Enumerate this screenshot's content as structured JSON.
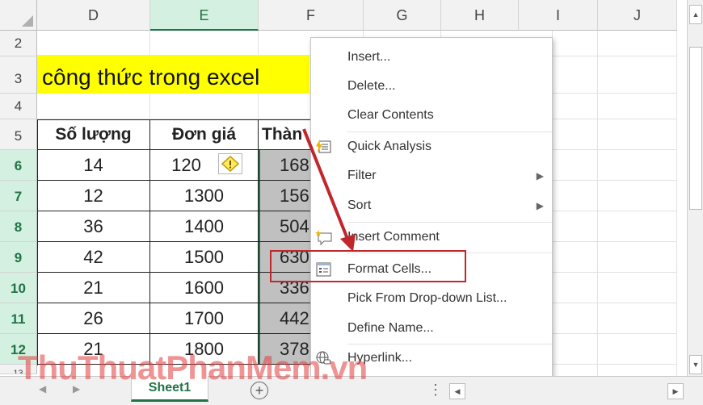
{
  "columns": {
    "d": "D",
    "e": "E",
    "f": "F",
    "g": "G",
    "h": "H",
    "i": "I",
    "j": "J"
  },
  "rows": [
    "2",
    "3",
    "4",
    "5",
    "6",
    "7",
    "8",
    "9",
    "10",
    "11",
    "12",
    "13"
  ],
  "title_cell": "công thức trong excel",
  "headers": {
    "qty": "Số lượng",
    "price": "Đơn giá",
    "total": "Thàn"
  },
  "data_rows": [
    {
      "qty": "14",
      "price": "120",
      "total": "168"
    },
    {
      "qty": "12",
      "price": "1300",
      "total": "156"
    },
    {
      "qty": "36",
      "price": "1400",
      "total": "504"
    },
    {
      "qty": "42",
      "price": "1500",
      "total": "630"
    },
    {
      "qty": "21",
      "price": "1600",
      "total": "336"
    },
    {
      "qty": "26",
      "price": "1700",
      "total": "442"
    },
    {
      "qty": "21",
      "price": "1800",
      "total": "378"
    }
  ],
  "context_menu": {
    "insert": "Insert...",
    "delete": "Delete...",
    "clear_contents": "Clear Contents",
    "quick_analysis": "Quick Analysis",
    "filter": "Filter",
    "sort": "Sort",
    "insert_comment": "Insert Comment",
    "format_cells": "Format Cells...",
    "pick_list": "Pick From Drop-down List...",
    "define_name": "Define Name...",
    "hyperlink": "Hyperlink..."
  },
  "sheet_tab": "Sheet1",
  "watermark": "ThuThuatPhanMem.vn",
  "colors": {
    "title_bg": "#ffff00",
    "accent_green": "#217346",
    "highlight_red": "#c0272d",
    "arrow_red": "#c0272d",
    "selection_gray": "#c0c0c0"
  }
}
